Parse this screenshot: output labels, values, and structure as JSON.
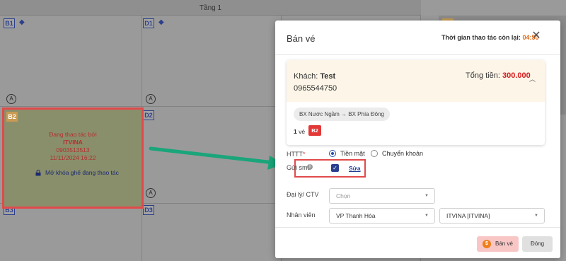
{
  "floor": {
    "title": "Tầng 1"
  },
  "seats": {
    "b1": "B1",
    "d1": "D1",
    "d_hidden": "D1",
    "a_marks": [
      "A",
      "A",
      "A",
      "A"
    ],
    "b2": "B2",
    "d2": "D2",
    "b3": "B3",
    "d3": "D3"
  },
  "locked_seat": {
    "line1": "Đang thao tác bởi",
    "line2": "ITVINA",
    "line3": "0903513513",
    "line4": "11/11/2024 16:22",
    "unlock_label": "Mở khóa ghế đang thao tác"
  },
  "modal": {
    "title": "Bán vé",
    "timer_label": "Thời gian thao tác còn lại:",
    "timer_value": "04:50",
    "customer_label": "Khách:",
    "customer_name": "Test",
    "phone": "0965544750",
    "total_label": "Tổng tiền:",
    "total_value": "300.000",
    "route": "BX Nước Ngầm → BX Phía Đông",
    "ticket_count": "1",
    "ticket_unit": "vé",
    "seat_badge": "B2",
    "payment_label": "HTTT",
    "payment_req": "*",
    "payment_options": [
      "Tiền mặt",
      "Chuyển khoản"
    ],
    "payment_selected": "Tiền mặt",
    "sms_label": "Gửi sms",
    "sms_info": "i",
    "sms_checked": true,
    "sms_edit": "Sửa",
    "agent_label": "Đại lý/ CTV",
    "agent_placeholder": "Chọn",
    "staff_label": "Nhân viên",
    "office_value": "VP Thanh Hóa",
    "staff_value": "ITVINA [ITVINA]",
    "sell_button": "Bán vé",
    "close_button": "Đóng"
  },
  "colors": {
    "accent": "#2a3f8f",
    "price": "#d61c1c",
    "timer": "#e26a1a",
    "highlight": "#e14a4a",
    "arrow": "#1aa57a"
  }
}
